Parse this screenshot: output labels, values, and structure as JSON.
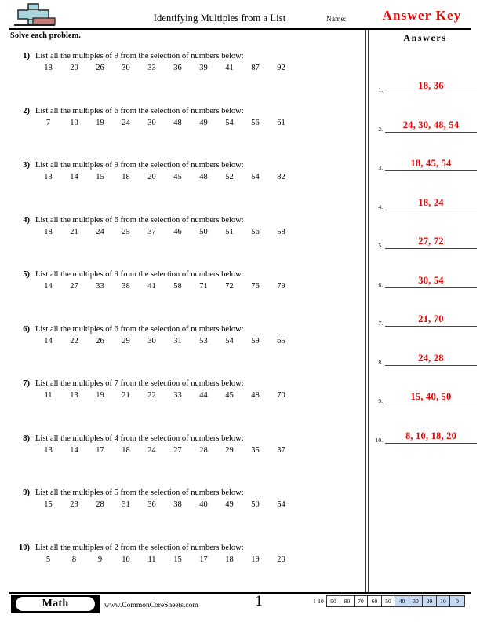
{
  "header": {
    "logo_icon": "plus-block-logo",
    "title": "Identifying Multiples from a List",
    "name_label": "Name:",
    "answer_key": "Answer Key",
    "answer_key_color": "#ee0000"
  },
  "instruction": "Solve each problem.",
  "answers_column": {
    "heading": "Answers",
    "rows": [
      {
        "number": "1.",
        "value": "18, 36"
      },
      {
        "number": "2.",
        "value": "24, 30, 48, 54"
      },
      {
        "number": "3.",
        "value": "18, 45, 54"
      },
      {
        "number": "4.",
        "value": "18, 24"
      },
      {
        "number": "5.",
        "value": "27, 72"
      },
      {
        "number": "6.",
        "value": "30, 54"
      },
      {
        "number": "7.",
        "value": "21, 70"
      },
      {
        "number": "8.",
        "value": "24, 28"
      },
      {
        "number": "9.",
        "value": "15, 40, 50"
      },
      {
        "number": "10.",
        "value": "8, 10, 18, 20"
      }
    ]
  },
  "problems": [
    {
      "number": "1)",
      "prompt": "List all the multiples of 9 from the selection of numbers below:",
      "numbers": [
        "18",
        "20",
        "26",
        "30",
        "33",
        "36",
        "39",
        "41",
        "87",
        "92"
      ]
    },
    {
      "number": "2)",
      "prompt": "List all the multiples of 6 from the selection of numbers below:",
      "numbers": [
        "7",
        "10",
        "19",
        "24",
        "30",
        "48",
        "49",
        "54",
        "56",
        "61"
      ]
    },
    {
      "number": "3)",
      "prompt": "List all the multiples of 9 from the selection of numbers below:",
      "numbers": [
        "13",
        "14",
        "15",
        "18",
        "20",
        "45",
        "48",
        "52",
        "54",
        "82"
      ]
    },
    {
      "number": "4)",
      "prompt": "List all the multiples of 6 from the selection of numbers below:",
      "numbers": [
        "18",
        "21",
        "24",
        "25",
        "37",
        "46",
        "50",
        "51",
        "56",
        "58"
      ]
    },
    {
      "number": "5)",
      "prompt": "List all the multiples of 9 from the selection of numbers below:",
      "numbers": [
        "14",
        "27",
        "33",
        "38",
        "41",
        "58",
        "71",
        "72",
        "76",
        "79"
      ]
    },
    {
      "number": "6)",
      "prompt": "List all the multiples of 6 from the selection of numbers below:",
      "numbers": [
        "14",
        "22",
        "26",
        "29",
        "30",
        "31",
        "53",
        "54",
        "59",
        "65"
      ]
    },
    {
      "number": "7)",
      "prompt": "List all the multiples of 7 from the selection of numbers below:",
      "numbers": [
        "11",
        "13",
        "19",
        "21",
        "22",
        "33",
        "44",
        "45",
        "48",
        "70"
      ]
    },
    {
      "number": "8)",
      "prompt": "List all the multiples of 4 from the selection of numbers below:",
      "numbers": [
        "13",
        "14",
        "17",
        "18",
        "24",
        "27",
        "28",
        "29",
        "35",
        "37"
      ]
    },
    {
      "number": "9)",
      "prompt": "List all the multiples of 5 from the selection of numbers below:",
      "numbers": [
        "15",
        "23",
        "28",
        "31",
        "36",
        "38",
        "40",
        "49",
        "50",
        "54"
      ]
    },
    {
      "number": "10)",
      "prompt": "List all the multiples of 2 from the selection of numbers below:",
      "numbers": [
        "5",
        "8",
        "9",
        "10",
        "11",
        "15",
        "17",
        "18",
        "19",
        "20"
      ]
    }
  ],
  "footer": {
    "subject_badge": "Math",
    "site_url": "www.CommonCoreSheets.com",
    "page_number": "1",
    "scale_label": "1-10",
    "scale_cells": [
      {
        "value": "90",
        "highlighted": false
      },
      {
        "value": "80",
        "highlighted": false
      },
      {
        "value": "70",
        "highlighted": false
      },
      {
        "value": "60",
        "highlighted": false
      },
      {
        "value": "50",
        "highlighted": false
      },
      {
        "value": "40",
        "highlighted": true
      },
      {
        "value": "30",
        "highlighted": true
      },
      {
        "value": "20",
        "highlighted": true
      },
      {
        "value": "10",
        "highlighted": true
      },
      {
        "value": "0",
        "highlighted": true
      }
    ],
    "scale_highlight_color": "#c5d9f1"
  }
}
